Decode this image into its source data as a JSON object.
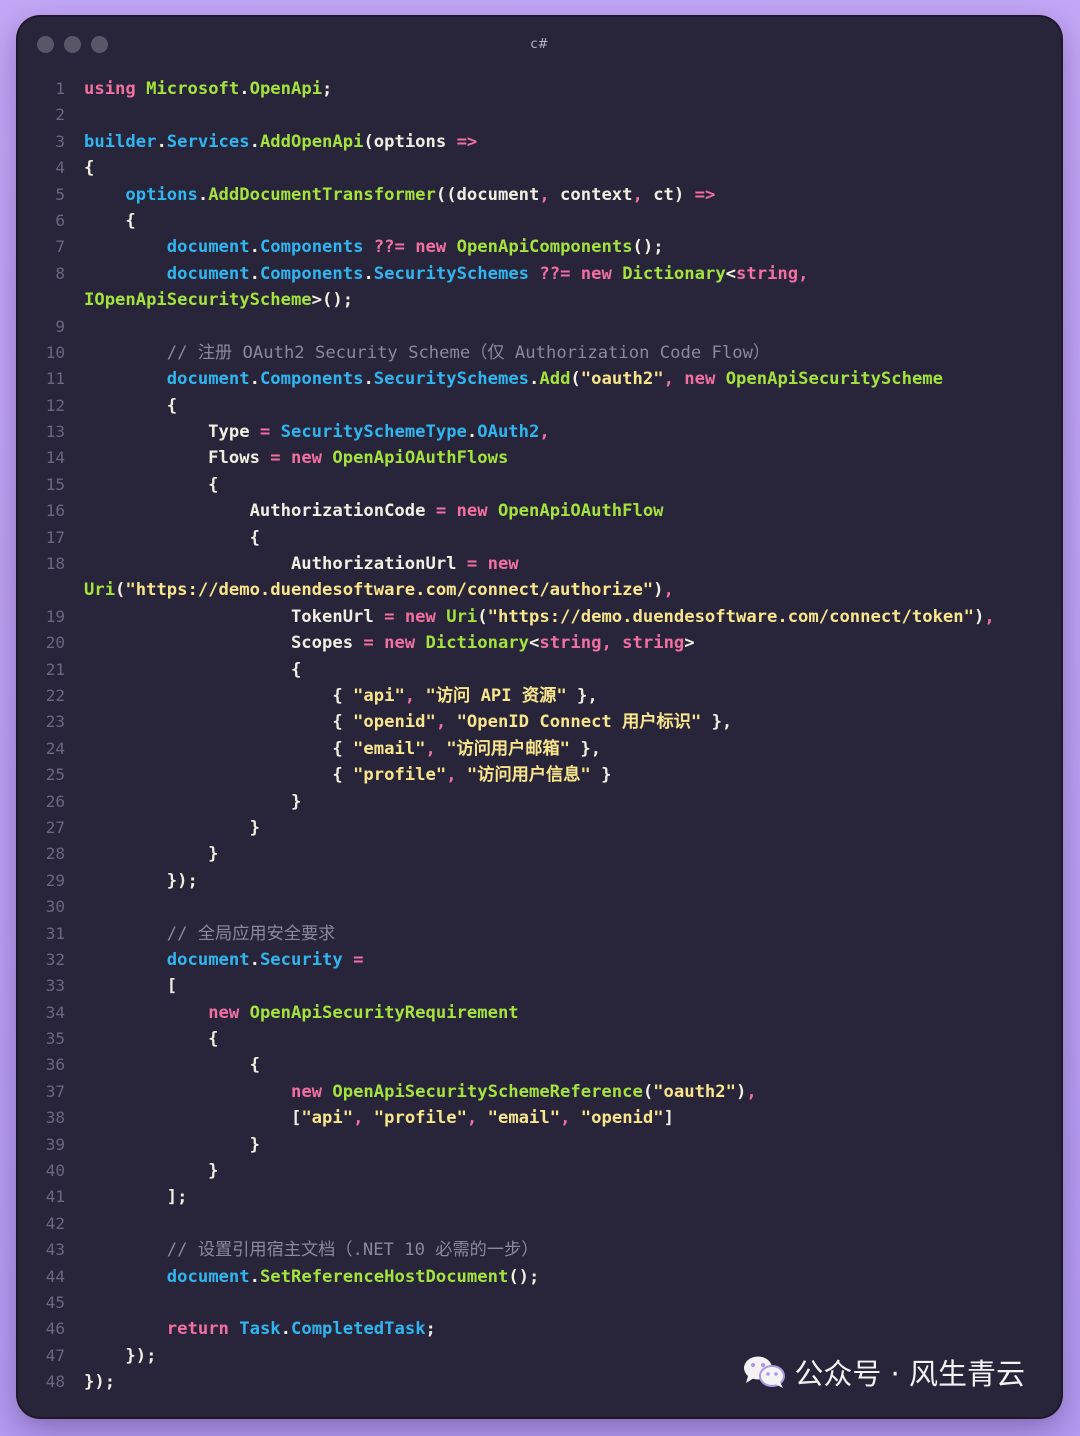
{
  "window": {
    "language_label": "c#"
  },
  "watermark": {
    "text": "公众号 · 风生青云",
    "icon": "wechat-icon"
  },
  "colors": {
    "background": "#b49af0",
    "editor_background": "#28253a",
    "line_number": "#6b6780",
    "plain": "#f2eee2",
    "keyword": "#f26fa2",
    "identifier": "#2fb6f0",
    "type": "#a3e33c",
    "string": "#f8e58c",
    "comment": "#8b889c",
    "punctuation": "#f26fa2"
  },
  "code": {
    "lines": [
      {
        "n": "1",
        "tokens": [
          [
            "using",
            "kw"
          ],
          [
            " ",
            "p"
          ],
          [
            "Microsoft",
            "ty"
          ],
          [
            ".",
            "p"
          ],
          [
            "OpenApi",
            "ty"
          ],
          [
            ";",
            "p"
          ]
        ]
      },
      {
        "n": "2",
        "tokens": []
      },
      {
        "n": "3",
        "tokens": [
          [
            "builder",
            "id"
          ],
          [
            ".",
            "p"
          ],
          [
            "Services",
            "id"
          ],
          [
            ".",
            "p"
          ],
          [
            "AddOpenApi",
            "ty"
          ],
          [
            "(options ",
            "p"
          ],
          [
            "=>",
            "kw"
          ]
        ]
      },
      {
        "n": "4",
        "tokens": [
          [
            "{",
            "p"
          ]
        ]
      },
      {
        "n": "5",
        "tokens": [
          [
            "    ",
            "p"
          ],
          [
            "options",
            "id"
          ],
          [
            ".",
            "p"
          ],
          [
            "AddDocumentTransformer",
            "ty"
          ],
          [
            "((document",
            "p"
          ],
          [
            ",",
            "kw"
          ],
          [
            " context",
            "p"
          ],
          [
            ",",
            "kw"
          ],
          [
            " ct) ",
            "p"
          ],
          [
            "=>",
            "kw"
          ]
        ]
      },
      {
        "n": "6",
        "tokens": [
          [
            "    {",
            "p"
          ]
        ]
      },
      {
        "n": "7",
        "tokens": [
          [
            "        ",
            "p"
          ],
          [
            "document",
            "id"
          ],
          [
            ".",
            "p"
          ],
          [
            "Components",
            "id"
          ],
          [
            " ",
            "p"
          ],
          [
            "??=",
            "kw"
          ],
          [
            " ",
            "p"
          ],
          [
            "new",
            "kw"
          ],
          [
            " ",
            "p"
          ],
          [
            "OpenApiComponents",
            "ty"
          ],
          [
            "();",
            "p"
          ]
        ]
      },
      {
        "n": "8",
        "tokens": [
          [
            "        ",
            "p"
          ],
          [
            "document",
            "id"
          ],
          [
            ".",
            "p"
          ],
          [
            "Components",
            "id"
          ],
          [
            ".",
            "p"
          ],
          [
            "SecuritySchemes",
            "id"
          ],
          [
            " ",
            "p"
          ],
          [
            "??=",
            "kw"
          ],
          [
            " ",
            "p"
          ],
          [
            "new",
            "kw"
          ],
          [
            " ",
            "p"
          ],
          [
            "Dictionary",
            "ty"
          ],
          [
            "<",
            "p"
          ],
          [
            "string",
            "kw"
          ],
          [
            ",",
            "kw"
          ]
        ]
      },
      {
        "n": "",
        "tokens": [
          [
            "IOpenApiSecurityScheme",
            "ty"
          ],
          [
            ">();",
            "p"
          ]
        ]
      },
      {
        "n": "9",
        "tokens": []
      },
      {
        "n": "10",
        "tokens": [
          [
            "        // 注册 OAuth2 Security Scheme（仅 Authorization Code Flow）",
            "cm"
          ]
        ]
      },
      {
        "n": "11",
        "tokens": [
          [
            "        ",
            "p"
          ],
          [
            "document",
            "id"
          ],
          [
            ".",
            "p"
          ],
          [
            "Components",
            "id"
          ],
          [
            ".",
            "p"
          ],
          [
            "SecuritySchemes",
            "id"
          ],
          [
            ".",
            "p"
          ],
          [
            "Add",
            "ty"
          ],
          [
            "(",
            "p"
          ],
          [
            "\"oauth2\"",
            "st"
          ],
          [
            ",",
            "kw"
          ],
          [
            " ",
            "p"
          ],
          [
            "new",
            "kw"
          ],
          [
            " ",
            "p"
          ],
          [
            "OpenApiSecurityScheme",
            "ty"
          ]
        ]
      },
      {
        "n": "12",
        "tokens": [
          [
            "        {",
            "p"
          ]
        ]
      },
      {
        "n": "13",
        "tokens": [
          [
            "            Type ",
            "p"
          ],
          [
            "=",
            "kw"
          ],
          [
            " ",
            "p"
          ],
          [
            "SecuritySchemeType",
            "id"
          ],
          [
            ".",
            "p"
          ],
          [
            "OAuth2",
            "id"
          ],
          [
            ",",
            "kw"
          ]
        ]
      },
      {
        "n": "14",
        "tokens": [
          [
            "            Flows ",
            "p"
          ],
          [
            "=",
            "kw"
          ],
          [
            " ",
            "p"
          ],
          [
            "new",
            "kw"
          ],
          [
            " ",
            "p"
          ],
          [
            "OpenApiOAuthFlows",
            "ty"
          ]
        ]
      },
      {
        "n": "15",
        "tokens": [
          [
            "            {",
            "p"
          ]
        ]
      },
      {
        "n": "16",
        "tokens": [
          [
            "                AuthorizationCode ",
            "p"
          ],
          [
            "=",
            "kw"
          ],
          [
            " ",
            "p"
          ],
          [
            "new",
            "kw"
          ],
          [
            " ",
            "p"
          ],
          [
            "OpenApiOAuthFlow",
            "ty"
          ]
        ]
      },
      {
        "n": "17",
        "tokens": [
          [
            "                {",
            "p"
          ]
        ]
      },
      {
        "n": "18",
        "tokens": [
          [
            "                    AuthorizationUrl ",
            "p"
          ],
          [
            "=",
            "kw"
          ],
          [
            " ",
            "p"
          ],
          [
            "new",
            "kw"
          ]
        ]
      },
      {
        "n": "",
        "tokens": [
          [
            "Uri",
            "ty"
          ],
          [
            "(",
            "p"
          ],
          [
            "\"https://demo.duendesoftware.com/connect/authorize\"",
            "st"
          ],
          [
            ")",
            "p"
          ],
          [
            ",",
            "kw"
          ]
        ]
      },
      {
        "n": "19",
        "tokens": [
          [
            "                    TokenUrl ",
            "p"
          ],
          [
            "=",
            "kw"
          ],
          [
            " ",
            "p"
          ],
          [
            "new",
            "kw"
          ],
          [
            " ",
            "p"
          ],
          [
            "Uri",
            "ty"
          ],
          [
            "(",
            "p"
          ],
          [
            "\"https://demo.duendesoftware.com/connect/token\"",
            "st"
          ],
          [
            ")",
            "p"
          ],
          [
            ",",
            "kw"
          ]
        ]
      },
      {
        "n": "20",
        "tokens": [
          [
            "                    Scopes ",
            "p"
          ],
          [
            "=",
            "kw"
          ],
          [
            " ",
            "p"
          ],
          [
            "new",
            "kw"
          ],
          [
            " ",
            "p"
          ],
          [
            "Dictionary",
            "ty"
          ],
          [
            "<",
            "p"
          ],
          [
            "string",
            "kw"
          ],
          [
            ",",
            "kw"
          ],
          [
            " ",
            "p"
          ],
          [
            "string",
            "kw"
          ],
          [
            ">",
            "p"
          ]
        ]
      },
      {
        "n": "21",
        "tokens": [
          [
            "                    {",
            "p"
          ]
        ]
      },
      {
        "n": "22",
        "tokens": [
          [
            "                        { ",
            "p"
          ],
          [
            "\"api\"",
            "st"
          ],
          [
            ",",
            "kw"
          ],
          [
            " ",
            "p"
          ],
          [
            "\"访问 API 资源\"",
            "st"
          ],
          [
            " },",
            "p"
          ]
        ]
      },
      {
        "n": "23",
        "tokens": [
          [
            "                        { ",
            "p"
          ],
          [
            "\"openid\"",
            "st"
          ],
          [
            ",",
            "kw"
          ],
          [
            " ",
            "p"
          ],
          [
            "\"OpenID Connect 用户标识\"",
            "st"
          ],
          [
            " },",
            "p"
          ]
        ]
      },
      {
        "n": "24",
        "tokens": [
          [
            "                        { ",
            "p"
          ],
          [
            "\"email\"",
            "st"
          ],
          [
            ",",
            "kw"
          ],
          [
            " ",
            "p"
          ],
          [
            "\"访问用户邮箱\"",
            "st"
          ],
          [
            " },",
            "p"
          ]
        ]
      },
      {
        "n": "25",
        "tokens": [
          [
            "                        { ",
            "p"
          ],
          [
            "\"profile\"",
            "st"
          ],
          [
            ",",
            "kw"
          ],
          [
            " ",
            "p"
          ],
          [
            "\"访问用户信息\"",
            "st"
          ],
          [
            " }",
            "p"
          ]
        ]
      },
      {
        "n": "26",
        "tokens": [
          [
            "                    }",
            "p"
          ]
        ]
      },
      {
        "n": "27",
        "tokens": [
          [
            "                }",
            "p"
          ]
        ]
      },
      {
        "n": "28",
        "tokens": [
          [
            "            }",
            "p"
          ]
        ]
      },
      {
        "n": "29",
        "tokens": [
          [
            "        });",
            "p"
          ]
        ]
      },
      {
        "n": "30",
        "tokens": []
      },
      {
        "n": "31",
        "tokens": [
          [
            "        // 全局应用安全要求",
            "cm"
          ]
        ]
      },
      {
        "n": "32",
        "tokens": [
          [
            "        ",
            "p"
          ],
          [
            "document",
            "id"
          ],
          [
            ".",
            "p"
          ],
          [
            "Security",
            "id"
          ],
          [
            " ",
            "p"
          ],
          [
            "=",
            "kw"
          ]
        ]
      },
      {
        "n": "33",
        "tokens": [
          [
            "        [",
            "p"
          ]
        ]
      },
      {
        "n": "34",
        "tokens": [
          [
            "            ",
            "p"
          ],
          [
            "new",
            "kw"
          ],
          [
            " ",
            "p"
          ],
          [
            "OpenApiSecurityRequirement",
            "ty"
          ]
        ]
      },
      {
        "n": "35",
        "tokens": [
          [
            "            {",
            "p"
          ]
        ]
      },
      {
        "n": "36",
        "tokens": [
          [
            "                {",
            "p"
          ]
        ]
      },
      {
        "n": "37",
        "tokens": [
          [
            "                    ",
            "p"
          ],
          [
            "new",
            "kw"
          ],
          [
            " ",
            "p"
          ],
          [
            "OpenApiSecuritySchemeReference",
            "ty"
          ],
          [
            "(",
            "p"
          ],
          [
            "\"oauth2\"",
            "st"
          ],
          [
            ")",
            "p"
          ],
          [
            ",",
            "kw"
          ]
        ]
      },
      {
        "n": "38",
        "tokens": [
          [
            "                    [",
            "p"
          ],
          [
            "\"api\"",
            "st"
          ],
          [
            ",",
            "kw"
          ],
          [
            " ",
            "p"
          ],
          [
            "\"profile\"",
            "st"
          ],
          [
            ",",
            "kw"
          ],
          [
            " ",
            "p"
          ],
          [
            "\"email\"",
            "st"
          ],
          [
            ",",
            "kw"
          ],
          [
            " ",
            "p"
          ],
          [
            "\"openid\"",
            "st"
          ],
          [
            "]",
            "p"
          ]
        ]
      },
      {
        "n": "39",
        "tokens": [
          [
            "                }",
            "p"
          ]
        ]
      },
      {
        "n": "40",
        "tokens": [
          [
            "            }",
            "p"
          ]
        ]
      },
      {
        "n": "41",
        "tokens": [
          [
            "        ];",
            "p"
          ]
        ]
      },
      {
        "n": "42",
        "tokens": []
      },
      {
        "n": "43",
        "tokens": [
          [
            "        // 设置引用宿主文档（.NET 10 必需的一步）",
            "cm"
          ]
        ]
      },
      {
        "n": "44",
        "tokens": [
          [
            "        ",
            "p"
          ],
          [
            "document",
            "id"
          ],
          [
            ".",
            "p"
          ],
          [
            "SetReferenceHostDocument",
            "ty"
          ],
          [
            "();",
            "p"
          ]
        ]
      },
      {
        "n": "45",
        "tokens": []
      },
      {
        "n": "46",
        "tokens": [
          [
            "        ",
            "p"
          ],
          [
            "return",
            "kw"
          ],
          [
            " ",
            "p"
          ],
          [
            "Task",
            "id"
          ],
          [
            ".",
            "p"
          ],
          [
            "CompletedTask",
            "id"
          ],
          [
            ";",
            "p"
          ]
        ]
      },
      {
        "n": "47",
        "tokens": [
          [
            "    });",
            "p"
          ]
        ]
      },
      {
        "n": "48",
        "tokens": [
          [
            "});",
            "p"
          ]
        ]
      }
    ]
  }
}
